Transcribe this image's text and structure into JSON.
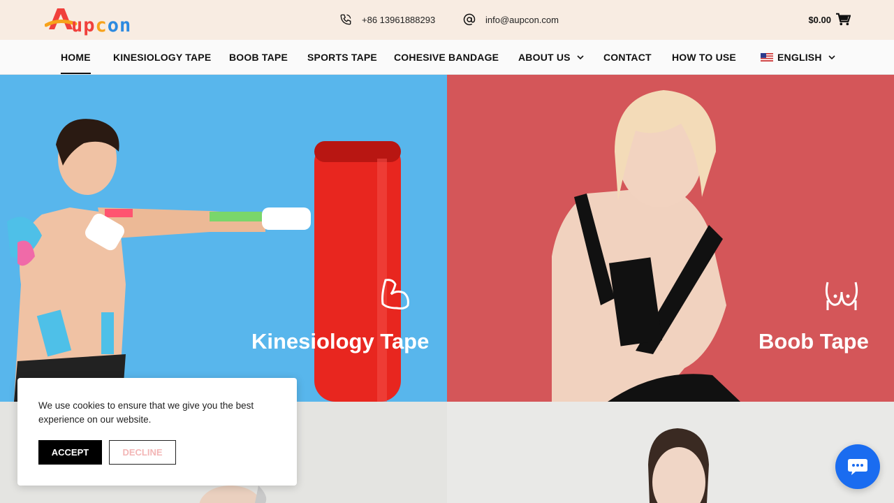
{
  "header": {
    "logo_text": [
      "A",
      "up",
      "c",
      "on"
    ],
    "phone": "+86 13961888293",
    "email": "info@aupcon.com",
    "cart_total": "$0.00"
  },
  "nav": {
    "items": [
      {
        "label": "HOME",
        "active": true
      },
      {
        "label": "KINESIOLOGY TAPE"
      },
      {
        "label": "BOOB TAPE"
      },
      {
        "label": "SPORTS TAPE"
      },
      {
        "label": "COHESIVE BANDAGE"
      },
      {
        "label": "ABOUT US",
        "has_dropdown": true
      },
      {
        "label": "CONTACT"
      },
      {
        "label": "HOW TO USE"
      },
      {
        "label": "ENGLISH",
        "has_dropdown": true,
        "icon": "us-flag-icon"
      }
    ]
  },
  "tiles": [
    {
      "title": "Kinesiology Tape",
      "icon": "flexed-arm-icon",
      "bg": "#58b6ec"
    },
    {
      "title": "Boob Tape",
      "icon": "breast-icon",
      "bg": "#d45659"
    }
  ],
  "cookie": {
    "message": "We use cookies to ensure that we give you the best experience on our website.",
    "accept_label": "ACCEPT",
    "decline_label": "DECLINE"
  },
  "colors": {
    "topbar": "#f8ece2",
    "chat": "#1a6cf0"
  }
}
